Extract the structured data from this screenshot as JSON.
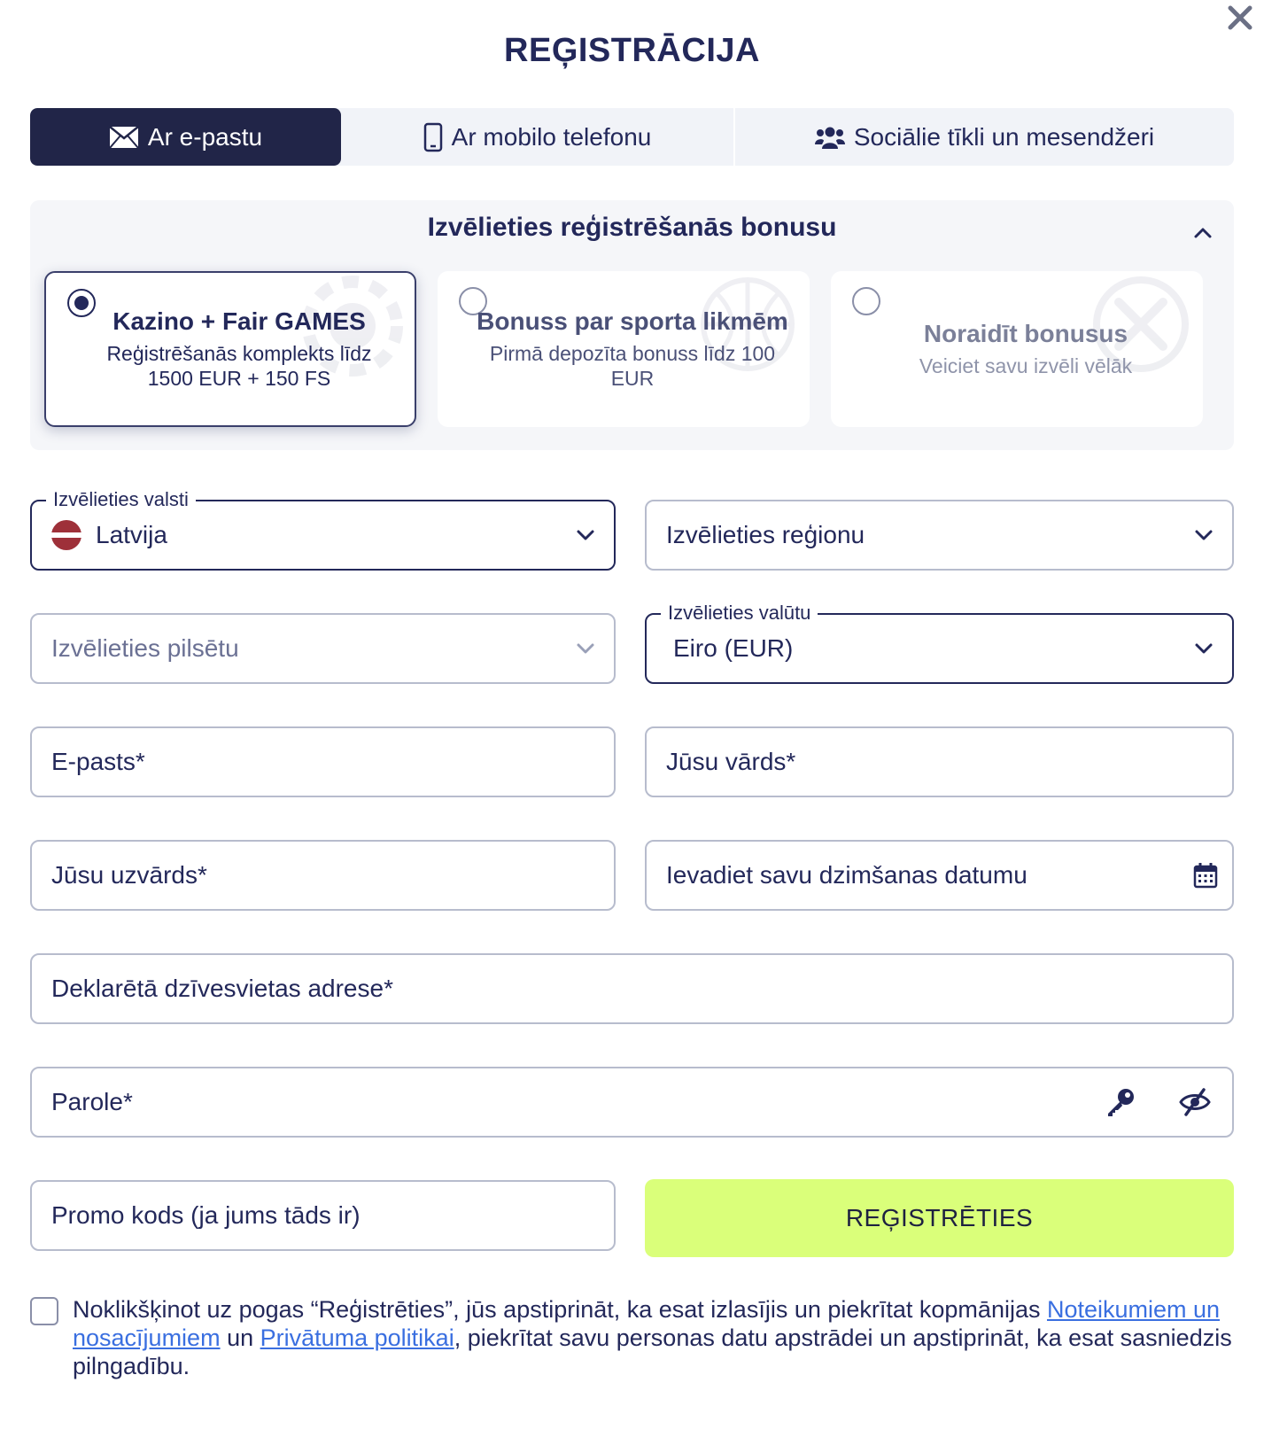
{
  "header": {
    "title": "REĢISTRĀCIJA"
  },
  "tabs": [
    {
      "label": "Ar e-pastu",
      "icon": "envelope-icon",
      "active": true
    },
    {
      "label": "Ar mobilo telefonu",
      "icon": "mobile-phone-icon",
      "active": false
    },
    {
      "label": "Sociālie tīkli un mesendžeri",
      "icon": "users-icon",
      "active": false
    }
  ],
  "bonus": {
    "title": "Izvēlieties reģistrēšanās bonusu",
    "options": [
      {
        "title": "Kazino + Fair GAMES",
        "subtitle": "Reģistrēšanās komplekts līdz 1500 EUR + 150 FS",
        "selected": true
      },
      {
        "title": "Bonuss par sporta likmēm",
        "subtitle": "Pirmā depozīta bonuss līdz 100 EUR",
        "selected": false
      },
      {
        "title": "Noraidīt bonusus",
        "subtitle": "Veiciet savu izvēli vēlāk",
        "selected": false
      }
    ]
  },
  "form": {
    "country": {
      "legend": "Izvēlieties valsti",
      "value": "Latvija"
    },
    "region": {
      "placeholder": "Izvēlieties reģionu"
    },
    "city": {
      "placeholder": "Izvēlieties pilsētu"
    },
    "currency": {
      "legend": "Izvēlieties valūtu",
      "value": "Eiro (EUR)"
    },
    "email": {
      "placeholder": "E-pasts*"
    },
    "first_name": {
      "placeholder": "Jūsu vārds*"
    },
    "last_name": {
      "placeholder": "Jūsu uzvārds*"
    },
    "birth_date": {
      "placeholder": "Ievadiet savu dzimšanas datumu"
    },
    "address": {
      "placeholder": "Deklarētā dzīvesvietas adrese*"
    },
    "password": {
      "placeholder": "Parole*"
    },
    "promo": {
      "placeholder": "Promo kods (ja jums tāds ir)"
    },
    "submit_label": "REĢISTRĒTIES"
  },
  "terms": {
    "prefix": "Noklikšķinot uz pogas “Reģistrēties”, jūs apstiprināt, ka esat izlasījis un piekrītat kopmānijas ",
    "link1": "Noteikumiem un nosacījumiem",
    "middle": " un ",
    "link2": "Privātuma politikai",
    "suffix": ", piekrītat savu personas datu apstrādei un apstiprināt, ka esat sasniedzis pilngadību."
  },
  "colors": {
    "primary": "#212548",
    "accent_button": "#daff7a",
    "link": "#3a6fe0"
  }
}
